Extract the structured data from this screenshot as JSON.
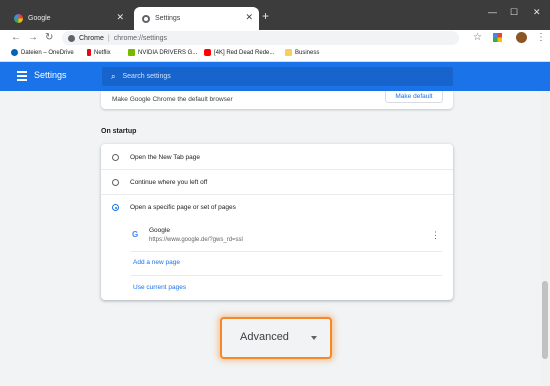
{
  "window": {
    "tabs": [
      {
        "label": "Google",
        "active": false
      },
      {
        "label": "Settings",
        "active": true
      }
    ],
    "new_tab": "+",
    "controls": {
      "minimize": "—",
      "maximize": "☐",
      "close": "✕"
    }
  },
  "toolbar": {
    "site_name": "Chrome",
    "url": "chrome://settings"
  },
  "bookmarks": [
    {
      "label": "Dateien – OneDrive",
      "color": "#0364b8"
    },
    {
      "label": "Netflix",
      "color": "#e50914"
    },
    {
      "label": "NVIDIA DRIVERS G...",
      "color": "#76b900"
    },
    {
      "label": "[4K] Red Dead Rede...",
      "color": "#ff0000"
    },
    {
      "label": "Business",
      "color": "#f9ce5b"
    }
  ],
  "header": {
    "title": "Settings",
    "search_placeholder": "Search settings"
  },
  "default_browser": {
    "text": "Make Google Chrome the default browser",
    "button": "Make default"
  },
  "startup": {
    "section_title": "On startup",
    "options": [
      {
        "label": "Open the New Tab page",
        "selected": false
      },
      {
        "label": "Continue where you left off",
        "selected": false
      },
      {
        "label": "Open a specific page or set of pages",
        "selected": true
      }
    ],
    "page": {
      "name": "Google",
      "url": "https://www.google.de/?gws_rd=ssl"
    },
    "add_page": "Add a new page",
    "use_current": "Use current pages"
  },
  "advanced": {
    "label": "Advanced"
  },
  "colors": {
    "accent": "#1a73e8",
    "highlight": "#f5892a"
  }
}
